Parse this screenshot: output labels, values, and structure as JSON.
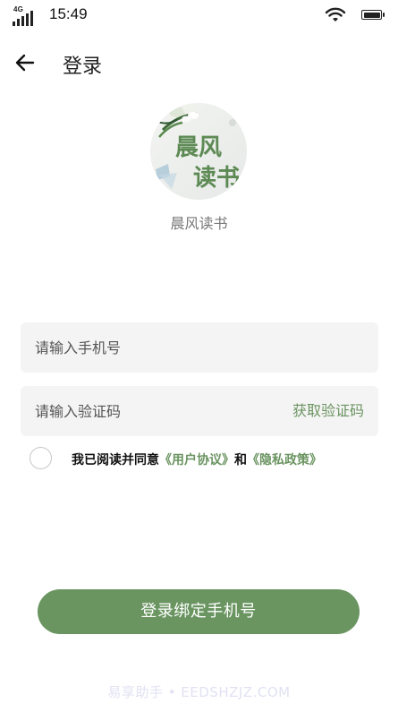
{
  "status_bar": {
    "network": "4G",
    "time": "15:49"
  },
  "header": {
    "title": "登录"
  },
  "logo": {
    "line1": "晨风",
    "line2": "读书"
  },
  "app_name": "晨风读书",
  "phone_input": {
    "placeholder": "请输入手机号",
    "value": ""
  },
  "code_input": {
    "placeholder": "请输入验证码",
    "value": "",
    "get_code_label": "获取验证码"
  },
  "agreement": {
    "checked": false,
    "prefix": "我已阅读并同意",
    "user_agreement": "《用户协议》",
    "conjunction": "和",
    "privacy_policy": "《隐私政策》"
  },
  "login_button": "登录绑定手机号",
  "watermark": "易享助手 • EEDSHZJZ.COM",
  "colors": {
    "accent": "#6a9561",
    "field_bg": "#f4f4f4",
    "text": "#222222"
  }
}
